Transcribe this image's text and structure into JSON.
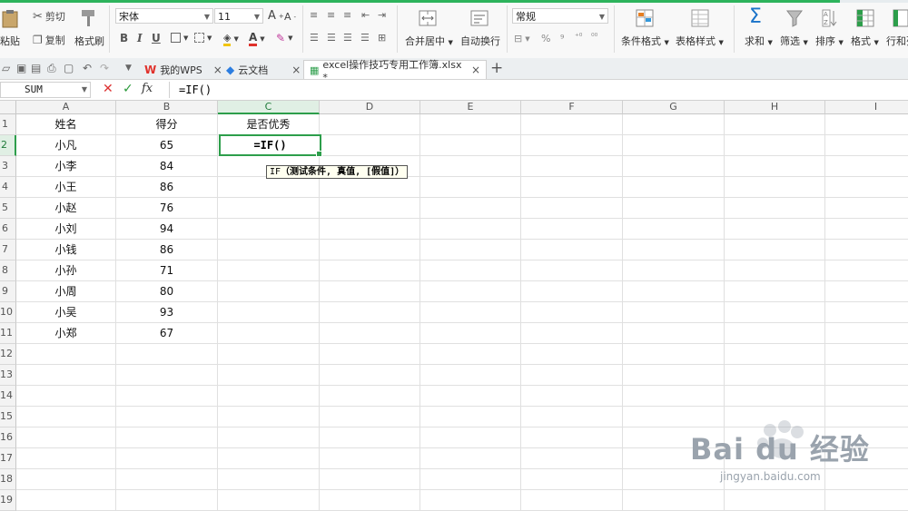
{
  "ribbon": {
    "paste_label": "粘贴",
    "cut_label": "剪切",
    "copy_label": "复制",
    "format_painter_label": "格式刷",
    "font_name": "宋体",
    "font_size": "11",
    "merge_label": "合并居中",
    "wrap_label": "自动换行",
    "number_format": "常规",
    "percent_symbol": "%",
    "conditional_format_label": "条件格式",
    "table_style_label": "表格样式",
    "sum_label": "求和",
    "filter_label": "筛选",
    "sort_label": "排序",
    "format_label": "格式",
    "rowcol_label": "行和列"
  },
  "tabs": [
    {
      "label": "我的WPS"
    },
    {
      "label": "云文档"
    },
    {
      "label": "excel操作技巧专用工作簿.xlsx *"
    }
  ],
  "formula_bar": {
    "name_box": "SUM",
    "fx_label": "fx",
    "formula": "=IF()"
  },
  "grid": {
    "columns": [
      "A",
      "B",
      "C",
      "D",
      "E",
      "F",
      "G",
      "H",
      "I"
    ],
    "rows": [
      "1",
      "2",
      "3",
      "4",
      "5",
      "6",
      "7",
      "8",
      "9",
      "10",
      "11",
      "12",
      "13",
      "14",
      "15",
      "16",
      "17",
      "18",
      "19"
    ],
    "cells": [
      {
        "a": "姓名",
        "b": "得分",
        "c": "是否优秀"
      },
      {
        "a": "小凡",
        "b": "65",
        "c": ""
      },
      {
        "a": "小李",
        "b": "84",
        "c": ""
      },
      {
        "a": "小王",
        "b": "86",
        "c": ""
      },
      {
        "a": "小赵",
        "b": "76",
        "c": ""
      },
      {
        "a": "小刘",
        "b": "94",
        "c": ""
      },
      {
        "a": "小钱",
        "b": "86",
        "c": ""
      },
      {
        "a": "小孙",
        "b": "71",
        "c": ""
      },
      {
        "a": "小周",
        "b": "80",
        "c": ""
      },
      {
        "a": "小吴",
        "b": "93",
        "c": ""
      },
      {
        "a": "小郑",
        "b": "67",
        "c": ""
      }
    ],
    "active_cell_value": "=IF()",
    "tooltip_func": "IF",
    "tooltip_args": "（测试条件, 真值, [假值]）"
  },
  "watermark": {
    "brand": "Bai du 经验",
    "url": "jingyan.baidu.com"
  },
  "colors": {
    "accent_green": "#2d9e4b",
    "wps_red": "#e0312b"
  }
}
